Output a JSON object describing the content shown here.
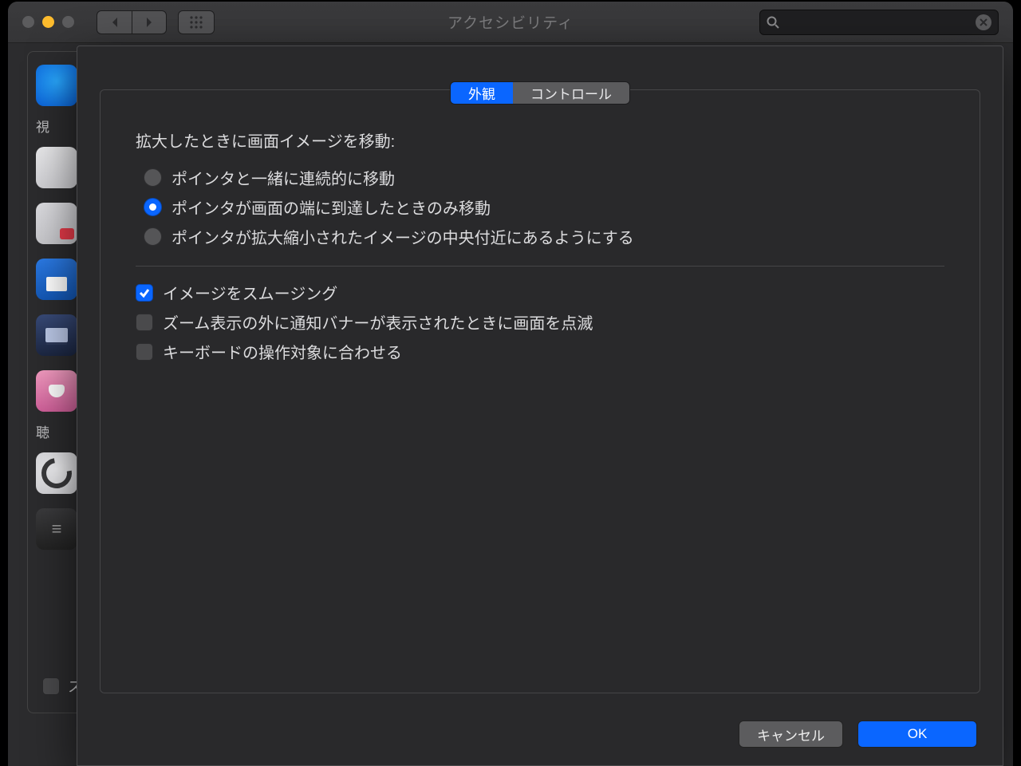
{
  "window": {
    "title": "アクセシビリティ"
  },
  "sidebar": {
    "section1_label": "視",
    "section2_label": "聴"
  },
  "footer": {
    "partial_label": "ス"
  },
  "sheet": {
    "tabs": {
      "appearance": "外観",
      "controls": "コントロール"
    },
    "group_label": "拡大したときに画面イメージを移動:",
    "radios": {
      "r1": "ポインタと一緒に連続的に移動",
      "r2": "ポインタが画面の端に到達したときのみ移動",
      "r3": "ポインタが拡大縮小されたイメージの中央付近にあるようにする"
    },
    "checks": {
      "c1": "イメージをスムージング",
      "c2": "ズーム表示の外に通知バナーが表示されたときに画面を点滅",
      "c3": "キーボードの操作対象に合わせる"
    },
    "buttons": {
      "cancel": "キャンセル",
      "ok": "OK"
    }
  },
  "help": "?"
}
